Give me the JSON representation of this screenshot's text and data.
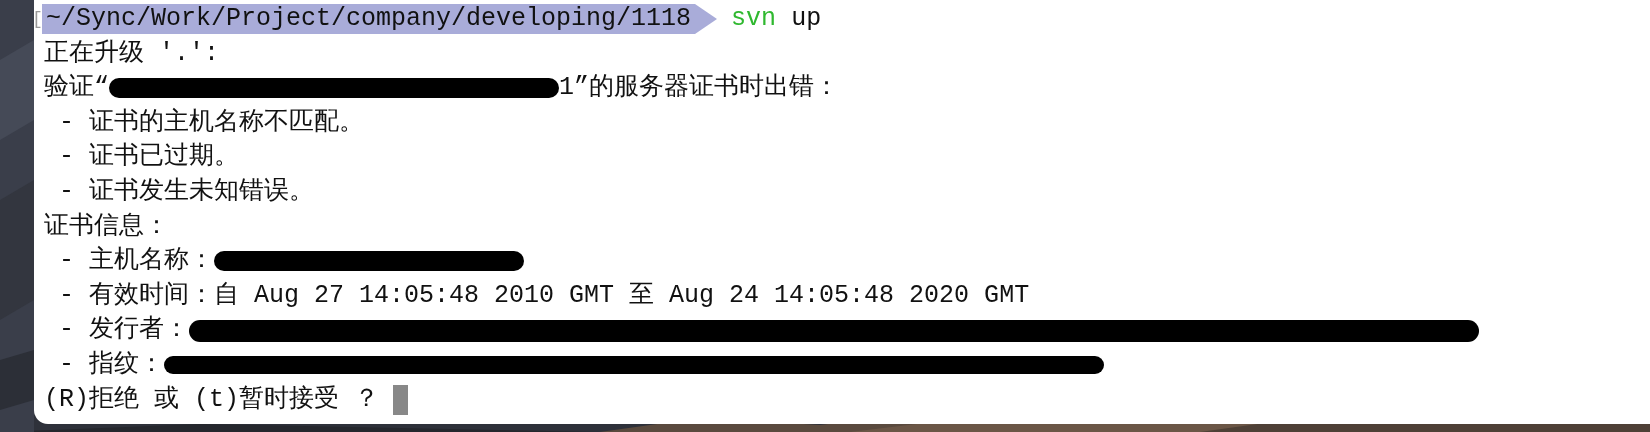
{
  "prompt": {
    "bracket": "[",
    "path": "~/Sync/Work/Project/company/developing/1118",
    "command": "svn",
    "args": "up"
  },
  "output": [
    {
      "segments": [
        {
          "kind": "text",
          "text": "正在升级 '.':"
        }
      ]
    },
    {
      "segments": [
        {
          "kind": "text",
          "text": "验证“"
        },
        {
          "kind": "redacted"
        },
        {
          "kind": "text",
          "text": "1”的服务器证书时出错："
        }
      ]
    },
    {
      "segments": [
        {
          "kind": "text",
          "text": " - 证书的主机名称不匹配。"
        }
      ]
    },
    {
      "segments": [
        {
          "kind": "text",
          "text": " - 证书已过期。"
        }
      ]
    },
    {
      "segments": [
        {
          "kind": "text",
          "text": " - 证书发生未知错误。"
        }
      ]
    },
    {
      "segments": [
        {
          "kind": "text",
          "text": "证书信息："
        }
      ]
    },
    {
      "segments": [
        {
          "kind": "text",
          "text": " - 主机名称："
        },
        {
          "kind": "redacted"
        }
      ]
    },
    {
      "segments": [
        {
          "kind": "text",
          "text": " - 有效时间：自 Aug 27 14:05:48 2010 GMT 至 Aug 24 14:05:48 2020 GMT"
        }
      ]
    },
    {
      "segments": [
        {
          "kind": "text",
          "text": " - 发行者："
        },
        {
          "kind": "redacted"
        }
      ]
    },
    {
      "segments": [
        {
          "kind": "text",
          "text": " - 指纹："
        },
        {
          "kind": "redacted"
        }
      ]
    }
  ],
  "input": {
    "text": "(R)拒绝 或 (t)暂时接受 ？",
    "cursor": true
  }
}
